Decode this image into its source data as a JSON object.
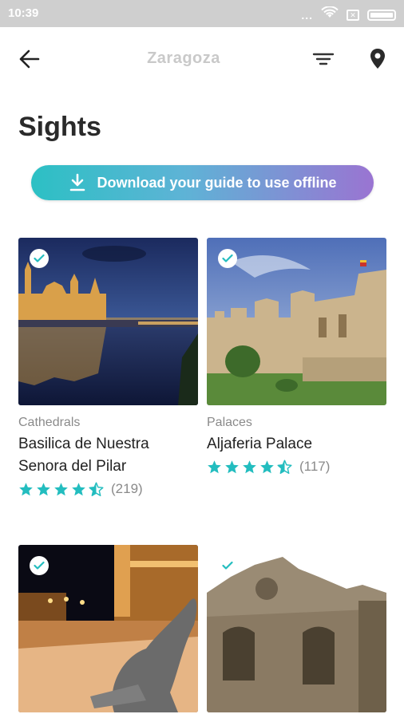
{
  "status_bar": {
    "time": "10:39",
    "signal_dots": "...",
    "sim_label": "✕"
  },
  "header": {
    "title": "Zaragoza"
  },
  "page": {
    "title": "Sights",
    "download_label": "Download your guide to use offline"
  },
  "colors": {
    "accent": "#23bdbf",
    "gradient_start": "#2cc0c4",
    "gradient_end": "#9a74d2"
  },
  "cards": [
    {
      "category": "Cathedrals",
      "name": "Basilica de Nuestra Senora del Pilar",
      "rating": 4.5,
      "reviews": "(219)",
      "checked": true
    },
    {
      "category": "Palaces",
      "name": "Aljaferia Palace",
      "rating": 4.5,
      "reviews": "(117)",
      "checked": true
    },
    {
      "checked": true
    },
    {
      "checked": true
    }
  ]
}
